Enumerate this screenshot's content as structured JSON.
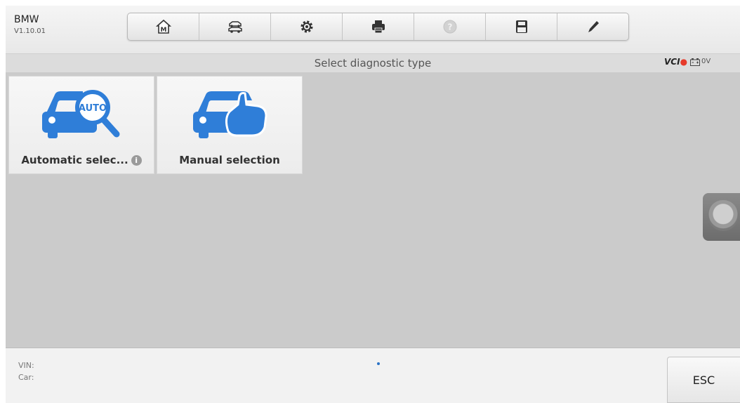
{
  "header": {
    "vehicle_name": "BMW",
    "version": "V1.10.01"
  },
  "toolbar": {
    "buttons": [
      {
        "icon": "home-icon",
        "enabled": true
      },
      {
        "icon": "vehicle-menu-icon",
        "enabled": true
      },
      {
        "icon": "settings-icon",
        "enabled": true
      },
      {
        "icon": "print-icon",
        "enabled": true
      },
      {
        "icon": "help-icon",
        "enabled": false
      },
      {
        "icon": "save-icon",
        "enabled": true
      },
      {
        "icon": "pen-icon",
        "enabled": true
      }
    ]
  },
  "titlebar": {
    "title": "Select diagnostic type",
    "vci_label": "VCI",
    "battery_voltage": "0V"
  },
  "tiles": [
    {
      "label": "Automatic selec...",
      "icon": "car-auto-search-icon",
      "has_info": true
    },
    {
      "label": "Manual selection",
      "icon": "car-hand-select-icon",
      "has_info": false
    }
  ],
  "footer": {
    "vin_label": "VIN:",
    "car_label": "Car:",
    "esc_label": "ESC"
  },
  "colors": {
    "icon_blue": "#2f7ed8",
    "content_bg": "#cbcbcb",
    "vci_accent": "#e63a2a"
  }
}
